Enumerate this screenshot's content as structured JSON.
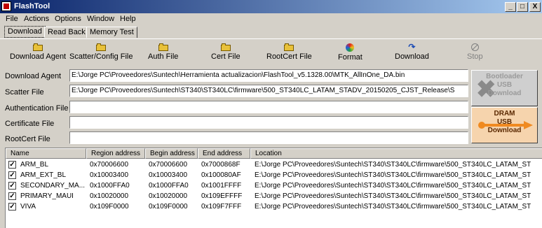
{
  "window": {
    "title": "FlashTool",
    "minimize": "_",
    "maximize": "□",
    "close": "X"
  },
  "menu": [
    "File",
    "Actions",
    "Options",
    "Window",
    "Help"
  ],
  "tabs": [
    "Download",
    "Read Back",
    "Memory Test"
  ],
  "toolbar": [
    {
      "label": "Download Agent",
      "icon": "folder-icon"
    },
    {
      "label": "Scatter/Config File",
      "icon": "folder-icon"
    },
    {
      "label": "Auth File",
      "icon": "folder-icon"
    },
    {
      "label": "Cert File",
      "icon": "folder-icon"
    },
    {
      "label": "RootCert File",
      "icon": "folder-icon"
    },
    {
      "label": "Format",
      "icon": "format-icon"
    },
    {
      "label": "Download",
      "icon": "download-icon"
    },
    {
      "label": "Stop",
      "icon": "stop-icon"
    }
  ],
  "fields": [
    {
      "label": "Download Agent",
      "value": "E:\\Jorge PC\\Proveedores\\Suntech\\Herramienta actualizacion\\FlashTool_v5.1328.00\\MTK_AllInOne_DA.bin"
    },
    {
      "label": "Scatter File",
      "value": "E:\\Jorge PC\\Proveedores\\Suntech\\ST340\\ST340LC\\firmware\\500_ST340LC_LATAM_STADV_20150205_CJST_Release\\S"
    },
    {
      "label": "Authentication File",
      "value": ""
    },
    {
      "label": "Certificate File",
      "value": ""
    },
    {
      "label": "RootCert File",
      "value": ""
    }
  ],
  "side_buttons": {
    "bootloader": [
      "Bootloader",
      "USB",
      "Download"
    ],
    "dram": [
      "DRAM",
      "USB",
      "Download"
    ]
  },
  "table": {
    "columns": [
      "Name",
      "Region address",
      "Begin address",
      "End address",
      "Location"
    ],
    "rows": [
      {
        "checked": true,
        "name": "ARM_BL",
        "region": "0x70006600",
        "begin": "0x70006600",
        "end": "0x7000868F",
        "location": "E:\\Jorge PC\\Proveedores\\Suntech\\ST340\\ST340LC\\firmware\\500_ST340LC_LATAM_ST"
      },
      {
        "checked": true,
        "name": "ARM_EXT_BL",
        "region": "0x10003400",
        "begin": "0x10003400",
        "end": "0x100080AF",
        "location": "E:\\Jorge PC\\Proveedores\\Suntech\\ST340\\ST340LC\\firmware\\500_ST340LC_LATAM_ST"
      },
      {
        "checked": true,
        "name": "SECONDARY_MA...",
        "region": "0x1000FFA0",
        "begin": "0x1000FFA0",
        "end": "0x1001FFFF",
        "location": "E:\\Jorge PC\\Proveedores\\Suntech\\ST340\\ST340LC\\firmware\\500_ST340LC_LATAM_ST"
      },
      {
        "checked": true,
        "name": "PRIMARY_MAUI",
        "region": "0x10020000",
        "begin": "0x10020000",
        "end": "0x109EFFFF",
        "location": "E:\\Jorge PC\\Proveedores\\Suntech\\ST340\\ST340LC\\firmware\\500_ST340LC_LATAM_ST"
      },
      {
        "checked": true,
        "name": "VIVA",
        "region": "0x109F0000",
        "begin": "0x109F0000",
        "end": "0x109F7FFF",
        "location": "E:\\Jorge PC\\Proveedores\\Suntech\\ST340\\ST340LC\\firmware\\500_ST340LC_LATAM_ST"
      }
    ]
  }
}
